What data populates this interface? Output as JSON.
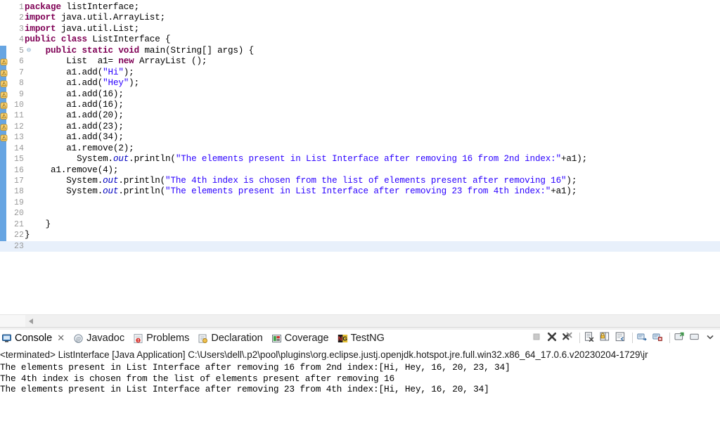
{
  "editor": {
    "first_line": 1,
    "last_line": 23,
    "current_line": 23,
    "change_bar_from_line": 5,
    "warning_lines": [
      6,
      7,
      8,
      9,
      10,
      11,
      12,
      13
    ],
    "fold_lines": [
      2,
      5
    ],
    "lines": [
      {
        "n": 1,
        "text": "package listInterface;"
      },
      {
        "n": 2,
        "text": "import java.util.ArrayList;"
      },
      {
        "n": 3,
        "text": "import java.util.List;"
      },
      {
        "n": 4,
        "text": "public class ListInterface {"
      },
      {
        "n": 5,
        "text": "    public static void main(String[] args) {"
      },
      {
        "n": 6,
        "text": "        List  a1= new ArrayList ();"
      },
      {
        "n": 7,
        "text": "        a1.add(\"Hi\");"
      },
      {
        "n": 8,
        "text": "        a1.add(\"Hey\");"
      },
      {
        "n": 9,
        "text": "        a1.add(16);"
      },
      {
        "n": 10,
        "text": "        a1.add(16);"
      },
      {
        "n": 11,
        "text": "        a1.add(20);"
      },
      {
        "n": 12,
        "text": "        a1.add(23);"
      },
      {
        "n": 13,
        "text": "        a1.add(34);"
      },
      {
        "n": 14,
        "text": "        a1.remove(2);"
      },
      {
        "n": 15,
        "text": "          System.out.println(\"The elements present in List Interface after removing 16 from 2nd index:\"+a1);"
      },
      {
        "n": 16,
        "text": "     a1.remove(4);"
      },
      {
        "n": 17,
        "text": "        System.out.println(\"The 4th index is chosen from the list of elements present after removing 16\");"
      },
      {
        "n": 18,
        "text": "        System.out.println(\"The elements present in List Interface after removing 23 from 4th index:\"+a1);"
      },
      {
        "n": 19,
        "text": ""
      },
      {
        "n": 20,
        "text": ""
      },
      {
        "n": 21,
        "text": "    }"
      },
      {
        "n": 22,
        "text": "}"
      },
      {
        "n": 23,
        "text": ""
      }
    ]
  },
  "console_panel": {
    "tabs": [
      {
        "label": "Console",
        "icon": "console-icon",
        "active": true,
        "closable": true
      },
      {
        "label": "Javadoc",
        "icon": "javadoc-icon",
        "active": false,
        "closable": false
      },
      {
        "label": "Problems",
        "icon": "problems-icon",
        "active": false,
        "closable": false
      },
      {
        "label": "Declaration",
        "icon": "declaration-icon",
        "active": false,
        "closable": false
      },
      {
        "label": "Coverage",
        "icon": "coverage-icon",
        "active": false,
        "closable": false
      },
      {
        "label": "TestNG",
        "icon": "testng-icon",
        "active": false,
        "closable": false
      }
    ],
    "toolbar": [
      {
        "name": "terminate-button",
        "enabled": false
      },
      {
        "name": "remove-launch-button",
        "enabled": true
      },
      {
        "name": "remove-all-terminated-button",
        "enabled": true
      },
      {
        "name": "clear-console-button",
        "enabled": true
      },
      {
        "name": "scroll-lock-button",
        "enabled": true
      },
      {
        "name": "word-wrap-button",
        "enabled": true
      },
      {
        "name": "show-console-on-output-button",
        "enabled": true
      },
      {
        "name": "pin-console-button",
        "enabled": true
      },
      {
        "name": "open-console-button",
        "enabled": true
      },
      {
        "name": "display-selected-console-button",
        "enabled": true
      },
      {
        "name": "view-menu-button",
        "enabled": true
      }
    ],
    "terminated_line": "<terminated> ListInterface [Java Application] C:\\Users\\dell\\.p2\\pool\\plugins\\org.eclipse.justj.openjdk.hotspot.jre.full.win32.x86_64_17.0.6.v20230204-1729\\jr",
    "output": [
      "The elements present in List Interface after removing 16 from 2nd index:[Hi, Hey, 16, 20, 23, 34]",
      "The 4th index is chosen from the list of elements present after removing 16",
      "The elements present in List Interface after removing 23 from 4th index:[Hi, Hey, 16, 20, 34]"
    ]
  },
  "colors": {
    "keyword": "#7f0055",
    "string": "#2a00ff",
    "field": "#0000c0",
    "change_bar": "#67a5e2",
    "current_line": "#e8f0fb",
    "warning": "#e8b73a"
  }
}
